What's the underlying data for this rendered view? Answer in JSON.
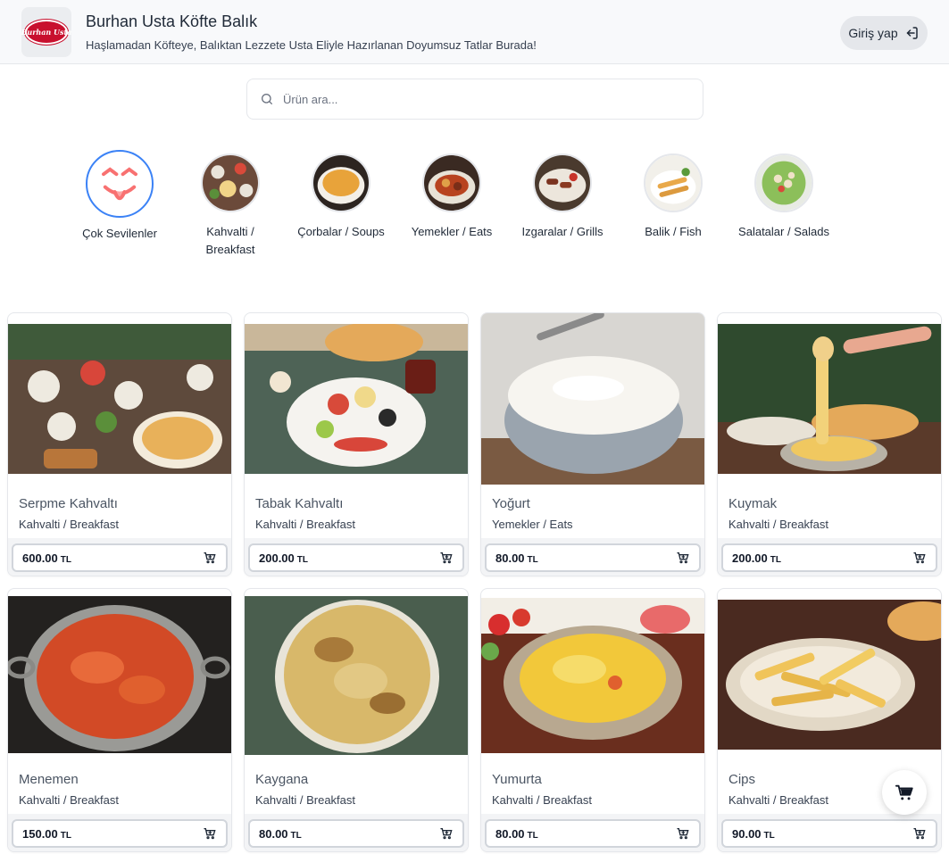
{
  "header": {
    "logo_text": "Burhan Usta",
    "title": "Burhan Usta Köfte Balık",
    "subtitle": "Haşlamadan Köfteye, Balıktan Lezzete Usta Eliyle Hazırlanan Doyumsuz Tatlar Burada!",
    "login_label": "Giriş yap"
  },
  "search": {
    "placeholder": "Ürün ara..."
  },
  "categories": [
    {
      "label": "Çok Sevilenler",
      "icon": "smile-tongue-icon",
      "active": true
    },
    {
      "label": "Kahvalti / Breakfast",
      "icon": "breakfast-photo"
    },
    {
      "label": "Çorbalar / Soups",
      "icon": "soup-photo"
    },
    {
      "label": "Yemekler / Eats",
      "icon": "stew-photo"
    },
    {
      "label": "Izgaralar / Grills",
      "icon": "grill-photo"
    },
    {
      "label": "Balik / Fish",
      "icon": "fish-photo"
    },
    {
      "label": "Salatalar / Salads",
      "icon": "salad-photo"
    }
  ],
  "products": [
    {
      "name": "Serpme Kahvaltı",
      "category": "Kahvalti / Breakfast",
      "price": "600.00",
      "currency": "TL"
    },
    {
      "name": "Tabak Kahvaltı",
      "category": "Kahvalti / Breakfast",
      "price": "200.00",
      "currency": "TL"
    },
    {
      "name": "Yoğurt",
      "category": "Yemekler / Eats",
      "price": "80.00",
      "currency": "TL"
    },
    {
      "name": "Kuymak",
      "category": "Kahvalti / Breakfast",
      "price": "200.00",
      "currency": "TL"
    },
    {
      "name": "Menemen",
      "category": "Kahvalti / Breakfast",
      "price": "150.00",
      "currency": "TL"
    },
    {
      "name": "Kaygana",
      "category": "Kahvalti / Breakfast",
      "price": "80.00",
      "currency": "TL"
    },
    {
      "name": "Yumurta",
      "category": "Kahvalti / Breakfast",
      "price": "80.00",
      "currency": "TL"
    },
    {
      "name": "Cips",
      "category": "Kahvalti / Breakfast",
      "price": "90.00",
      "currency": "TL"
    }
  ],
  "colors": {
    "accent": "#3b82f6",
    "brand": "#c8102e",
    "header_bg": "#f8f9fb"
  }
}
